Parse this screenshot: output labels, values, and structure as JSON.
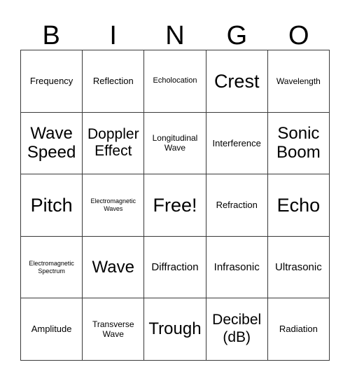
{
  "card": {
    "title": "BINGO Card",
    "header_letters": [
      "B",
      "I",
      "N",
      "G",
      "O"
    ],
    "border_color": "#3a3a3a",
    "background_color": "#ffffff",
    "text_color": "#000000",
    "rows": [
      [
        {
          "label": "Frequency",
          "size": "m"
        },
        {
          "label": "Reflection",
          "size": "m"
        },
        {
          "label": "Echolocation",
          "size": "xs"
        },
        {
          "label": "Crest",
          "size": "xxxl"
        },
        {
          "label": "Wavelength",
          "size": "s"
        }
      ],
      [
        {
          "label": "Wave\nSpeed",
          "size": "xxl"
        },
        {
          "label": "Doppler\nEffect",
          "size": "xl"
        },
        {
          "label": "Longitudinal\nWave",
          "size": "s"
        },
        {
          "label": "Interference",
          "size": "m"
        },
        {
          "label": "Sonic\nBoom",
          "size": "xxl"
        }
      ],
      [
        {
          "label": "Pitch",
          "size": "xxxl"
        },
        {
          "label": "Electromagnetic\nWaves",
          "size": "xxs"
        },
        {
          "label": "Free!",
          "size": "xxxl"
        },
        {
          "label": "Refraction",
          "size": "m"
        },
        {
          "label": "Echo",
          "size": "xxxl"
        }
      ],
      [
        {
          "label": "Electromagnetic\nSpectrum",
          "size": "xxs"
        },
        {
          "label": "Wave",
          "size": "xxl"
        },
        {
          "label": "Diffraction",
          "size": "l"
        },
        {
          "label": "Infrasonic",
          "size": "l"
        },
        {
          "label": "Ultrasonic",
          "size": "l"
        }
      ],
      [
        {
          "label": "Amplitude",
          "size": "m"
        },
        {
          "label": "Transverse\nWave",
          "size": "s"
        },
        {
          "label": "Trough",
          "size": "xxl"
        },
        {
          "label": "Decibel\n(dB)",
          "size": "xl"
        },
        {
          "label": "Radiation",
          "size": "m"
        }
      ]
    ]
  }
}
